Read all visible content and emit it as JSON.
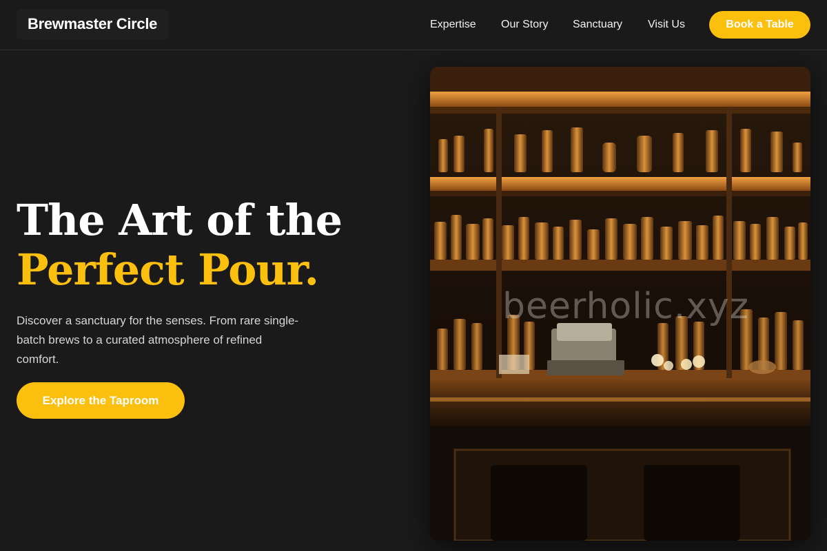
{
  "header": {
    "logo": "Brewmaster Circle",
    "nav": [
      "Expertise",
      "Our Story",
      "Sanctuary",
      "Visit Us"
    ],
    "book_button": "Book a Table"
  },
  "hero": {
    "title_line1": "The Art of the",
    "title_line2": "Perfect Pour.",
    "description": "Discover a sanctuary for the senses. From rare single-batch brews to a curated atmosphere of refined comfort.",
    "cta": "Explore the Taproom"
  },
  "image": {
    "subject": "bar shelves stocked with liquor bottles above a wooden counter",
    "watermark": "beerholic.xyz"
  },
  "colors": {
    "accent": "#fbbf0e",
    "background": "#1a1a1a",
    "text": "#ffffff"
  }
}
